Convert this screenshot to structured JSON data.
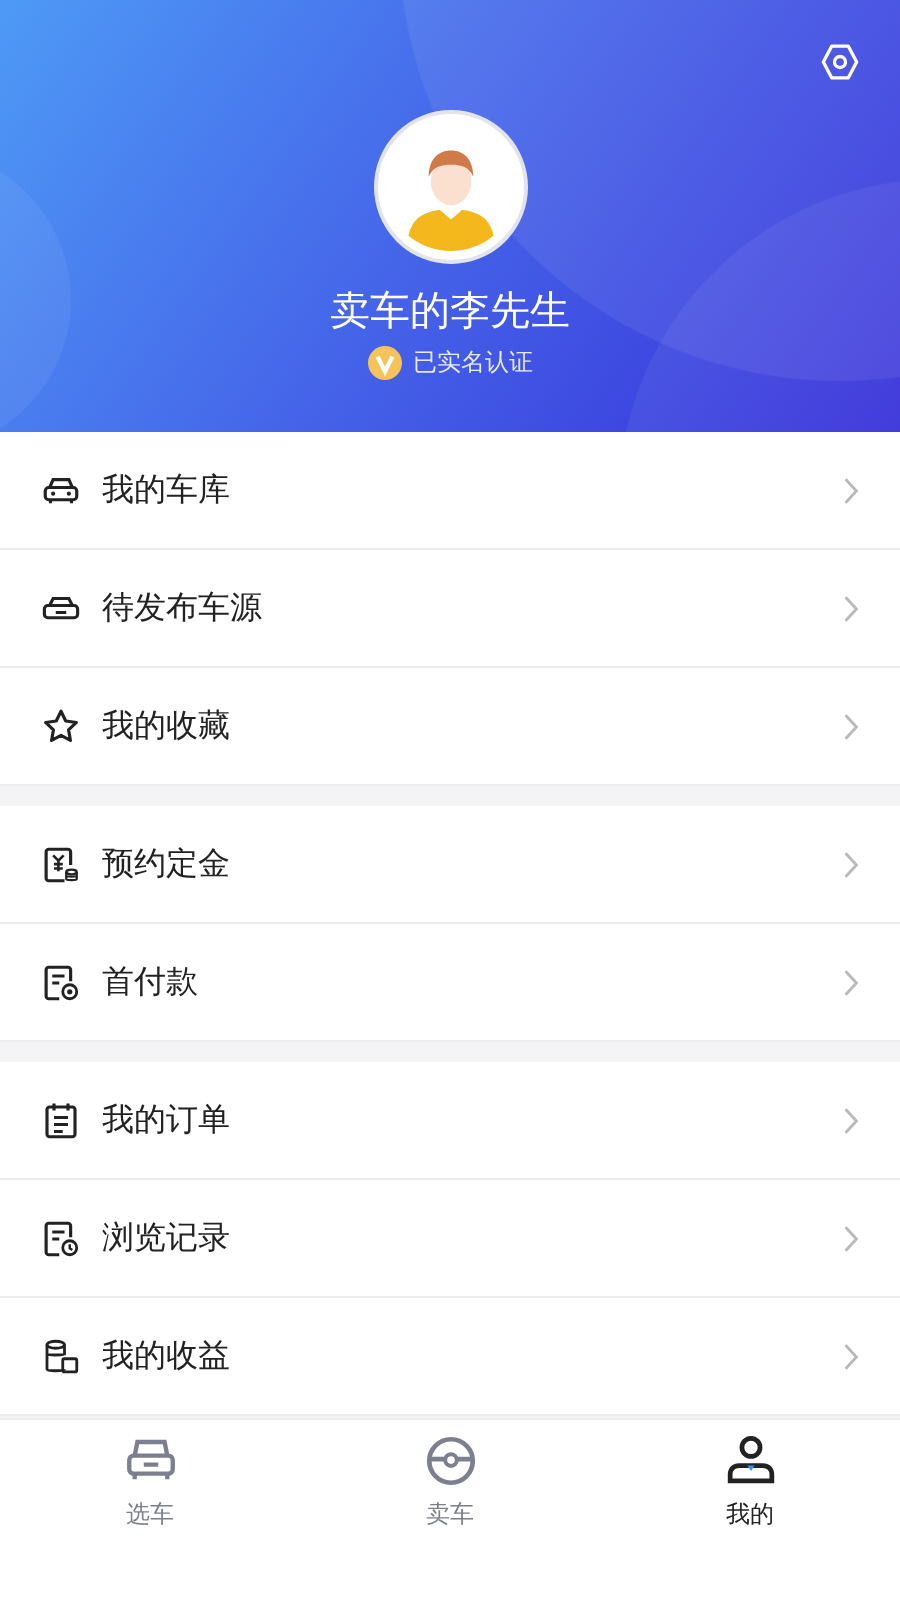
{
  "profile": {
    "name": "卖车的李先生",
    "verification": "已实名认证",
    "verified": true
  },
  "menu_groups": [
    {
      "items": [
        {
          "kind": "car",
          "label": "我的车库"
        },
        {
          "kind": "listing",
          "label": "待发布车源"
        },
        {
          "kind": "star",
          "label": "我的收藏"
        }
      ]
    },
    {
      "items": [
        {
          "kind": "deposit",
          "label": "预约定金"
        },
        {
          "kind": "payment",
          "label": "首付款"
        }
      ]
    },
    {
      "items": [
        {
          "kind": "order",
          "label": "我的订单"
        },
        {
          "kind": "history",
          "label": "浏览记录"
        },
        {
          "kind": "earnings",
          "label": "我的收益"
        }
      ]
    }
  ],
  "tab_bar": [
    {
      "kind": "browse",
      "label": "选车",
      "selected": false
    },
    {
      "kind": "sell",
      "label": "卖车",
      "selected": false
    },
    {
      "kind": "mine",
      "label": "我的",
      "selected": true
    }
  ]
}
